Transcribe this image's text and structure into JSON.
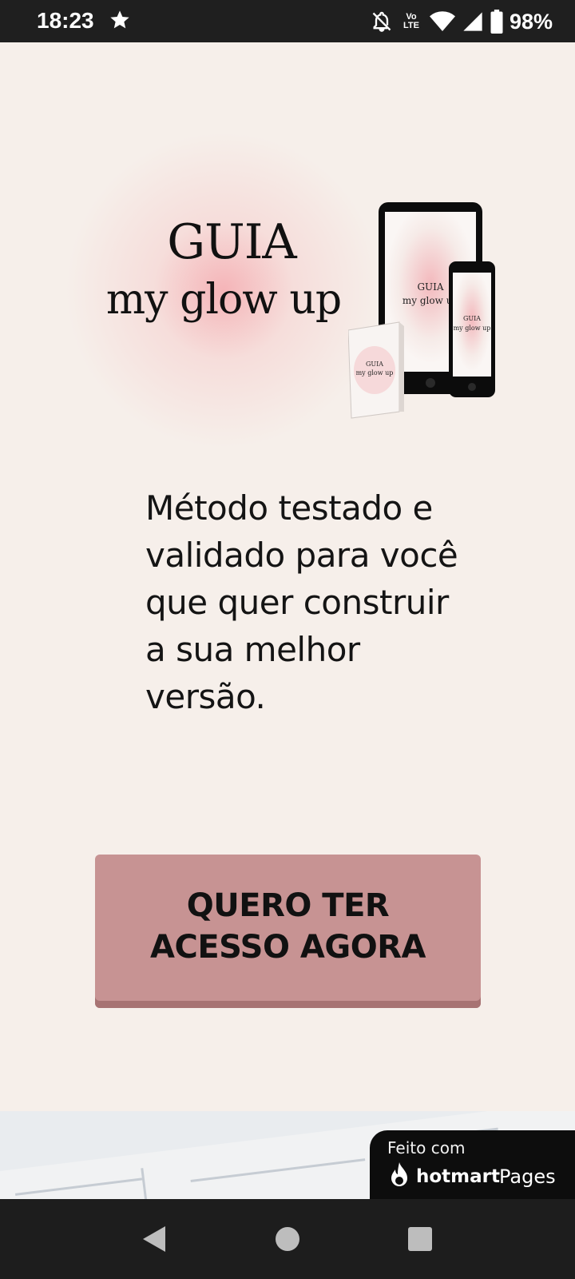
{
  "status_bar": {
    "time": "18:23",
    "lte_top": "Vo",
    "lte_bottom": "LTE",
    "battery": "98%",
    "icons": [
      "star-icon",
      "bell-off-icon",
      "volte-icon",
      "wifi-icon",
      "signal-icon",
      "battery-icon"
    ]
  },
  "hero": {
    "logo_line1": "GUIA",
    "logo_line2": "my glow up",
    "device_screen_title": "GUIA",
    "device_screen_sub": "my glow up",
    "headline": "Método testado e validado para você que quer construir a sua melhor versão.",
    "cta": "QUERO TER\nACESSO AGORA"
  },
  "badge": {
    "made_with": "Feito com",
    "brand": "hotmart",
    "product": "Pages"
  },
  "nav": {
    "icons": [
      "back-icon",
      "home-icon",
      "recents-icon"
    ]
  },
  "colors": {
    "background": "#f6efea",
    "cta": "#c79393",
    "cta_shadow": "#a77373",
    "status_bar": "#1f1f1f",
    "nav_bar": "#1d1d1d"
  }
}
